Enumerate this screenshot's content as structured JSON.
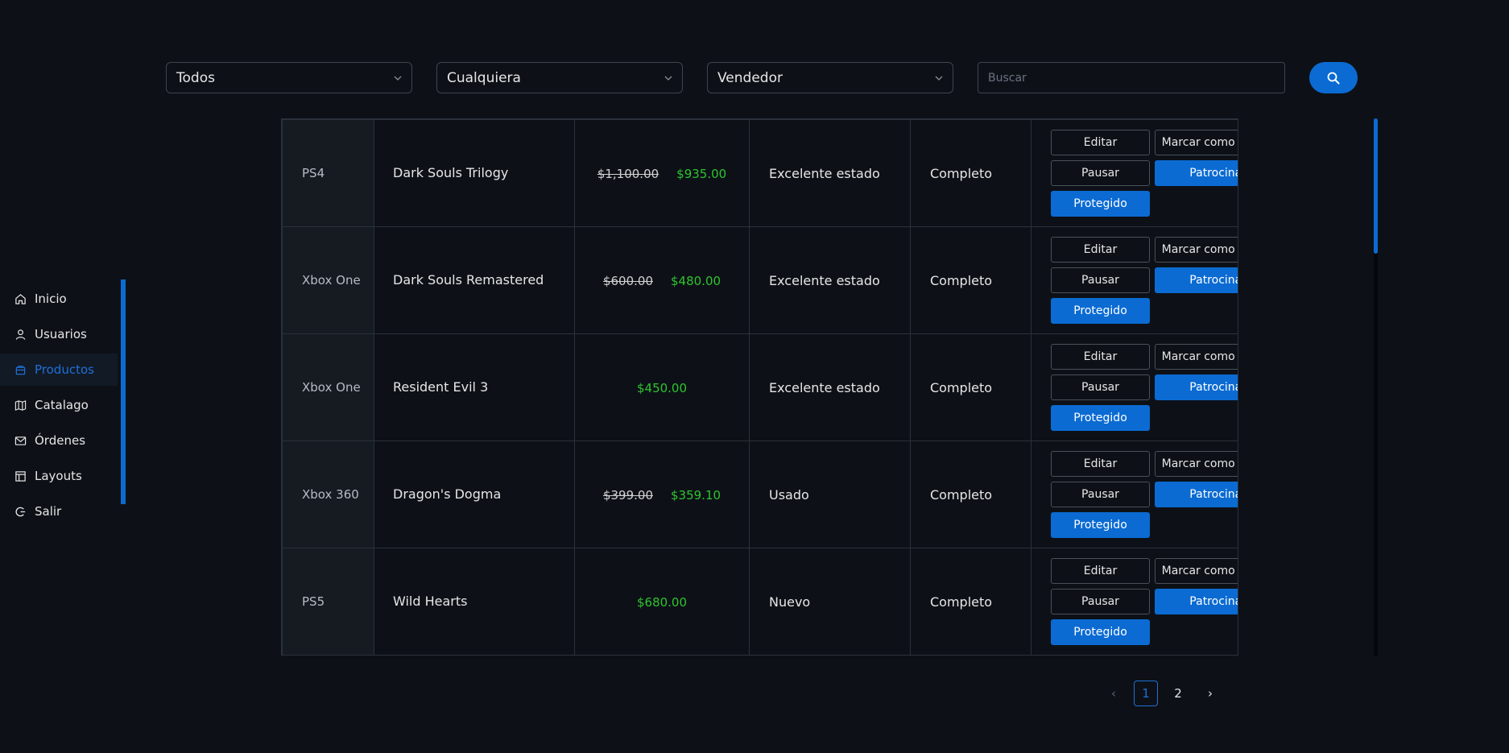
{
  "filters": {
    "platform": "Todos",
    "condition": "Cualquiera",
    "seller": "Vendedor",
    "search_placeholder": "Buscar"
  },
  "sidebar": {
    "items": [
      {
        "label": "Inicio",
        "icon": "home-icon"
      },
      {
        "label": "Usuarios",
        "icon": "user-icon"
      },
      {
        "label": "Productos",
        "icon": "box-icon",
        "active": true
      },
      {
        "label": "Catalago",
        "icon": "map-icon"
      },
      {
        "label": "Órdenes",
        "icon": "mail-icon"
      },
      {
        "label": "Layouts",
        "icon": "layout-icon"
      },
      {
        "label": "Salir",
        "icon": "logout-icon"
      }
    ]
  },
  "actions": {
    "edit": "Editar",
    "mark_sold": "Marcar como Vendido",
    "pause": "Pausar",
    "sponsored": "Patrocinado",
    "protected": "Protegido"
  },
  "rows": [
    {
      "platform": "PS4",
      "title": "Dark Souls Trilogy",
      "old_price": "$1,100.00",
      "price": "$935.00",
      "condition": "Excelente estado",
      "status": "Completo"
    },
    {
      "platform": "Xbox One",
      "title": "Dark Souls Remastered",
      "old_price": "$600.00",
      "price": "$480.00",
      "condition": "Excelente estado",
      "status": "Completo"
    },
    {
      "platform": "Xbox One",
      "title": "Resident Evil 3",
      "old_price": "",
      "price": "$450.00",
      "condition": "Excelente estado",
      "status": "Completo"
    },
    {
      "platform": "Xbox 360",
      "title": "Dragon's Dogma",
      "old_price": "$399.00",
      "price": "$359.10",
      "condition": "Usado",
      "status": "Completo"
    },
    {
      "platform": "PS5",
      "title": "Wild Hearts",
      "old_price": "",
      "price": "$680.00",
      "condition": "Nuevo",
      "status": "Completo"
    }
  ],
  "pagination": {
    "prev": "‹",
    "pages": [
      "1",
      "2"
    ],
    "current": "1",
    "next": "›"
  },
  "colors": {
    "accent": "#0b6bd3",
    "price_green": "#2fc32f",
    "background": "#0d1117"
  }
}
